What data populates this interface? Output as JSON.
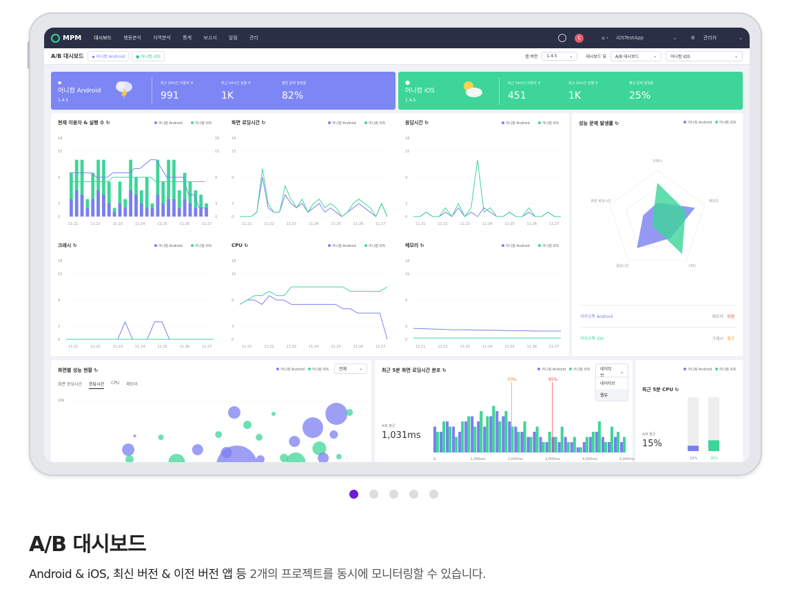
{
  "nav": {
    "brand": "MPM",
    "menu": [
      "대시보드",
      "행동분석",
      "지역분석",
      "통계",
      "보고서",
      "알림",
      "관리"
    ],
    "active_menu": "대시보드",
    "avatar_letter": "C",
    "app_breadcrumb": "iOSTestApp",
    "admin_label": "관리자"
  },
  "subbar": {
    "title": "A/B 대시보드",
    "tag_android": "어니컴 Android",
    "tag_ios": "어니컴 iOS",
    "app_version_label": "앱 버전",
    "app_version_value": "1.4.5",
    "dashboard_view_label": "대시보드 뷰",
    "dashboard_view_value": "A/B 대시보드",
    "project_value": "어니컴 iOS"
  },
  "hero_android": {
    "name": "어니컴 Android",
    "version": "1.4.5",
    "weather_icon": "thunderstorm-icon",
    "stats": [
      {
        "label": "최근 24시간 이용자 수",
        "value": "991"
      },
      {
        "label": "최근 24시간 실행 수",
        "value": "1K"
      },
      {
        "label": "평균 문제 발생률",
        "value": "82%"
      }
    ]
  },
  "hero_ios": {
    "name": "어니컴 iOS",
    "version": "1.4.5",
    "weather_icon": "partly-cloudy-icon",
    "stats": [
      {
        "label": "최근 24시간 이용자 수",
        "value": "451"
      },
      {
        "label": "최근 24시간 실행 수",
        "value": "1K"
      },
      {
        "label": "평균 문제 발생률",
        "value": "25%"
      }
    ]
  },
  "legend": {
    "android": "어니컴 Android",
    "ios": "어니컴 iOS"
  },
  "charts": {
    "users": {
      "title": "현재 이용자 & 실행 수"
    },
    "loading": {
      "title": "화면 로딩시간"
    },
    "response": {
      "title": "응답시간"
    },
    "crash": {
      "title": "크래시"
    },
    "cpu": {
      "title": "CPU"
    },
    "memory": {
      "title": "메모리"
    }
  },
  "chart_data": [
    {
      "type": "bar",
      "title": "현재 이용자 & 실행 수",
      "categories": [
        "11:21",
        "11:22",
        "11:23",
        "11:24",
        "11:25",
        "11:26",
        "11:27"
      ],
      "ylim": [
        0,
        18
      ],
      "yticks": [
        0,
        3,
        9,
        15,
        18
      ],
      "series": [
        {
          "name": "어니컴 Android",
          "values": [
            4,
            6,
            5,
            2,
            4,
            6,
            5,
            3,
            1,
            3,
            2,
            6,
            5,
            3,
            2,
            2,
            5,
            3,
            4,
            4,
            2,
            4,
            3,
            2,
            2,
            2
          ]
        },
        {
          "name": "어니컴 iOS",
          "values": [
            10,
            13,
            13,
            4,
            10,
            13,
            13,
            8,
            2,
            8,
            4,
            13,
            9,
            6,
            9,
            3,
            13,
            8,
            13,
            13,
            6,
            10,
            8,
            6,
            5,
            3
          ]
        }
      ]
    },
    {
      "type": "line",
      "title": "화면 로딩시간",
      "x": [
        "11:21",
        "11:22",
        "11:23",
        "11:24",
        "11:25",
        "11:26",
        "11:27"
      ],
      "ylim": [
        0,
        18
      ],
      "series": [
        {
          "name": "어니컴 Android",
          "values": [
            0,
            0,
            0,
            1,
            9,
            2,
            1,
            1,
            5,
            3,
            2,
            3,
            1,
            2,
            3,
            1,
            2,
            1,
            0,
            1,
            2,
            3,
            2,
            1,
            0,
            3,
            0
          ]
        },
        {
          "name": "어니컴 iOS",
          "values": [
            0,
            0,
            0,
            1,
            11,
            3,
            1,
            1,
            7,
            4,
            2,
            4,
            1,
            3,
            4,
            2,
            3,
            2,
            0,
            1,
            3,
            4,
            3,
            2,
            0,
            3,
            0
          ]
        }
      ]
    },
    {
      "type": "line",
      "title": "응답시간",
      "x": [
        "11:21",
        "11:22",
        "11:23",
        "11:24",
        "11:25",
        "11:26",
        "11:27"
      ],
      "ylim": [
        0,
        18
      ],
      "series": [
        {
          "name": "어니컴 Android",
          "values": [
            0,
            0,
            1,
            0,
            0,
            1,
            0,
            2,
            0,
            1,
            0,
            2,
            1,
            0,
            0,
            1,
            0,
            0,
            1,
            0,
            0,
            1,
            0,
            0
          ]
        },
        {
          "name": "어니컴 iOS",
          "values": [
            0,
            0,
            1,
            0,
            0,
            2,
            0,
            3,
            0,
            2,
            13,
            1,
            2,
            0,
            0,
            1,
            0,
            0,
            2,
            0,
            0,
            1,
            0,
            0
          ]
        }
      ]
    },
    {
      "type": "line",
      "title": "크래시",
      "x": [
        "11:21",
        "11:22",
        "11:23",
        "11:24",
        "11:25",
        "11:26",
        "11:27"
      ],
      "ylim": [
        0,
        18
      ],
      "series": [
        {
          "name": "어니컴 Android",
          "values": [
            0,
            0,
            0,
            0,
            0,
            0,
            0,
            0,
            4,
            0,
            0,
            0,
            4,
            4,
            0,
            0,
            0,
            0,
            0,
            0,
            0
          ]
        },
        {
          "name": "어니컴 iOS",
          "values": [
            0,
            0,
            0,
            0,
            0,
            0,
            0,
            0,
            0,
            0,
            0,
            0,
            0,
            0,
            0,
            0,
            0,
            0,
            0,
            0,
            0
          ]
        }
      ]
    },
    {
      "type": "line",
      "title": "CPU",
      "x": [
        "11:21",
        "11:22",
        "11:23",
        "11:24",
        "11:25",
        "11:26",
        "11:27"
      ],
      "ylim": [
        0,
        18
      ],
      "series": [
        {
          "name": "어니컴 Android",
          "values": [
            8,
            9,
            9,
            8,
            10,
            9,
            9,
            8,
            8,
            8,
            8,
            8,
            8,
            8,
            7,
            7,
            6,
            6,
            6,
            6,
            0
          ]
        },
        {
          "name": "어니컴 iOS",
          "values": [
            8,
            9,
            10,
            10,
            11,
            10,
            10,
            12,
            12,
            12,
            12,
            12,
            12,
            12,
            12,
            11,
            11,
            11,
            11,
            11,
            12
          ]
        }
      ]
    },
    {
      "type": "line",
      "title": "메모리",
      "x": [
        "11:21",
        "11:22",
        "11:23",
        "11:24",
        "11:25",
        "11:26",
        "11:27"
      ],
      "ylim": [
        0,
        18
      ],
      "series": [
        {
          "name": "어니컴 Android",
          "values": [
            2.5,
            2.4,
            2.3,
            2.2,
            2.2,
            2.1,
            2.1,
            2,
            2,
            1.9,
            1.9,
            1.9
          ]
        },
        {
          "name": "어니컴 iOS",
          "values": [
            0.3,
            0.3,
            0.3,
            0.3,
            0.3,
            0.3,
            0.3,
            0.3,
            0.3,
            0.3,
            0.3,
            0.3
          ]
        }
      ]
    },
    {
      "type": "radar",
      "title": "성능 문제 발생률",
      "categories": [
        "크래시",
        "메모리",
        "CPU",
        "응답시간",
        "화면 로딩시간"
      ],
      "series": [
        {
          "name": "어니컴 Android",
          "values": [
            0.35,
            0.8,
            0.45,
            0.7,
            0.3
          ]
        },
        {
          "name": "어니컴 iOS",
          "values": [
            0.75,
            0.6,
            0.85,
            0.15,
            0.1
          ]
        }
      ]
    },
    {
      "type": "bar",
      "title": "최근 5분 화면 로딩시간 분포",
      "xticks": [
        "0",
        "1,000ms",
        "2,000ms",
        "3,000ms",
        "4,000ms",
        "5,000ms"
      ],
      "markers": [
        {
          "label": "50%",
          "x": 2100
        },
        {
          "label": "95%",
          "x": 3200
        }
      ],
      "series": [
        {
          "name": "어니컴 Android",
          "values": [
            5,
            4,
            6,
            5,
            4,
            6,
            7,
            6,
            5,
            7,
            8,
            7,
            6,
            5,
            4,
            3,
            4,
            3,
            2,
            3,
            2,
            3,
            2,
            1,
            2,
            3,
            4,
            3,
            2,
            3,
            2
          ]
        },
        {
          "name": "어니컴 iOS",
          "values": [
            4,
            6,
            5,
            3,
            6,
            7,
            5,
            8,
            7,
            9,
            6,
            8,
            5,
            4,
            6,
            3,
            5,
            2,
            4,
            3,
            5,
            2,
            3,
            1,
            3,
            4,
            6,
            2,
            5,
            4,
            3
          ]
        }
      ]
    },
    {
      "type": "bar",
      "title": "최근 5분 CPU",
      "categories": [
        "어니컴 Android",
        "어니컴 iOS"
      ],
      "values": [
        10,
        20
      ],
      "value_labels": [
        "10%",
        "20%"
      ],
      "ylim": [
        0,
        100
      ]
    }
  ],
  "radar": {
    "title": "성능 문제 발생률",
    "rows": [
      {
        "name": "카카오톡 Android",
        "metric": "메모리",
        "status": "위험",
        "status_color": "#e84a4a"
      },
      {
        "name": "카카오톡 iOS",
        "metric": "크래시",
        "status": "경고",
        "status_color": "#f08a24"
      }
    ]
  },
  "bubble": {
    "title": "화면별 성능 현황",
    "filter_value": "전체",
    "tabs": [
      "화면 로딩시간",
      "응답시간",
      "CPU",
      "메모리"
    ],
    "active_tab": "응답시간",
    "y_label": "10k"
  },
  "dist": {
    "title": "최근 5분 화면 로딩시간 분포",
    "avg_label": "A/B 평균",
    "avg_value": "1,031ms",
    "dropdown_value": "네이티브",
    "dropdown_options": [
      "네이티브",
      "웹뷰"
    ]
  },
  "cpu_mini": {
    "title": "최근 5분 CPU",
    "avg_label": "A/B 평균",
    "avg_value": "15%"
  },
  "caption": {
    "title": "A/B 대시보드",
    "desc_prefix": "Android & iOS, 최신 버전 & 이전 버전 앱 등 ",
    "desc_highlight": "2개의 프로젝트를 동시에 모니터링할 수 있습니다."
  },
  "colors": {
    "android": "#7b7ff0",
    "ios": "#3dd598",
    "nav": "#2b2f45"
  }
}
